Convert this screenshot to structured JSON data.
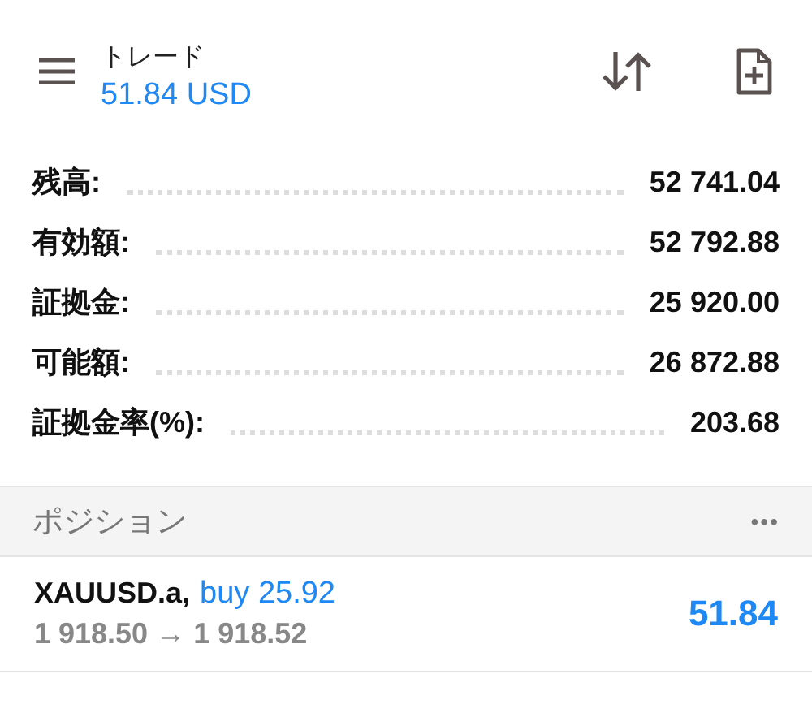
{
  "header": {
    "title": "トレード",
    "balance": "51.84 USD"
  },
  "summary": [
    {
      "label": "残高:",
      "value": "52 741.04"
    },
    {
      "label": "有効額:",
      "value": "52 792.88"
    },
    {
      "label": "証拠金:",
      "value": "25 920.00"
    },
    {
      "label": "可能額:",
      "value": "26 872.88"
    },
    {
      "label": "証拠金率(%):",
      "value": "203.68"
    }
  ],
  "positions": {
    "title": "ポジション",
    "more": "•••",
    "items": [
      {
        "symbol": "XAUUSD.a,",
        "order": "buy 25.92",
        "prices": "1 918.50 → 1 918.52",
        "profit": "51.84"
      }
    ]
  }
}
